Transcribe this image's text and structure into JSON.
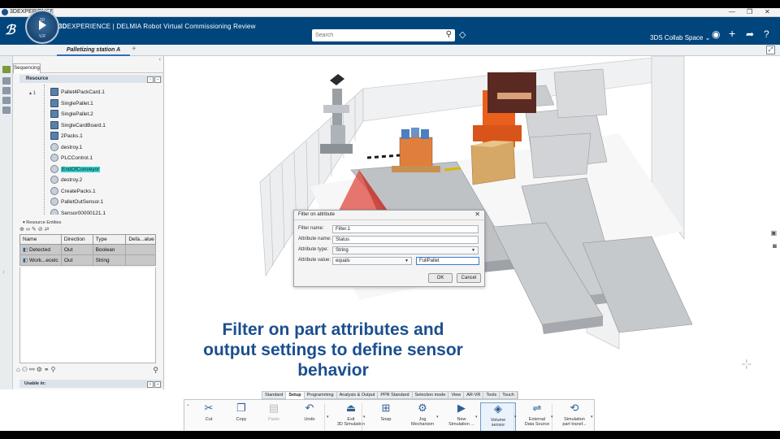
{
  "os_window": {
    "title": "3DEXPERIENCE",
    "controls": [
      "—",
      "❐",
      "✕"
    ]
  },
  "header": {
    "brand_bold": "3D",
    "brand_rest": "EXPERIENCE | DELMIA Robot Virtual Commissioning Review",
    "compass_labels": {
      "top": "3D",
      "bottom": "V,R"
    },
    "search_placeholder": "Search",
    "collab_space": "3DS Collab Space ⌄",
    "icons": [
      "user-icon",
      "plus-icon",
      "share-icon",
      "help-icon"
    ]
  },
  "tabbar": {
    "active_tab": "Palletizing station A",
    "add_label": "+"
  },
  "panel": {
    "tab_label": "Sequencing",
    "resource_header": "Resource",
    "tree_root_toggle": "▴ 1",
    "tree_items": [
      {
        "label": "Pallet4PackCard.1",
        "icon": "part-icon"
      },
      {
        "label": "SinglePallet.1",
        "icon": "part-icon"
      },
      {
        "label": "SinglePallet.2",
        "icon": "part-icon"
      },
      {
        "label": "SingleCardBoard.1",
        "icon": "part-icon"
      },
      {
        "label": "2Packs.1",
        "icon": "part-icon"
      },
      {
        "label": "destroy.1",
        "icon": "resource-icon"
      },
      {
        "label": "PLCControl.1",
        "icon": "resource-icon"
      },
      {
        "label": "EndOfConveyor",
        "icon": "sensor-icon",
        "highlighted": true
      },
      {
        "label": "destroy.2",
        "icon": "resource-icon"
      },
      {
        "label": "CreatePacks.1",
        "icon": "resource-icon"
      },
      {
        "label": "PalletOutSensor.1",
        "icon": "resource-icon"
      },
      {
        "label": "Sensor00000121.1",
        "icon": "resource-icon"
      }
    ],
    "entities_header": "▾ Resource Entities",
    "entities_columns": [
      "Name",
      "Direction",
      "Type",
      "Defa...alue"
    ],
    "entities_rows": [
      {
        "name": "Detected",
        "direction": "Out",
        "type": "Boolean",
        "default": ""
      },
      {
        "name": "Work...ecelc",
        "direction": "Out",
        "type": "String",
        "default": ""
      }
    ],
    "usable_header": "Usable in:"
  },
  "dialog": {
    "title": "Filter on attribute",
    "close": "✕",
    "filter_name_label": "Filter name:",
    "filter_name_value": "Filter.1",
    "attribute_name_label": "Attribute name:",
    "attribute_name_value": "Status",
    "attribute_type_label": "Attribute type:",
    "attribute_type_value": "String",
    "attribute_value_label": "Attribute value:",
    "operator_value": "equals",
    "value_text": "FullPallet",
    "ok_label": "OK",
    "cancel_label": "Cancel"
  },
  "caption": {
    "line1": "Filter on part attributes and",
    "line2": "output settings to define sensor",
    "line3": "behavior"
  },
  "ribbon": {
    "tabs": [
      "Standard",
      "Setup",
      "Programming",
      "Analysis & Output",
      "PPR Standard",
      "Selection mode",
      "View",
      "AR-VR",
      "Tools",
      "Touch"
    ],
    "active_tab": "Setup",
    "buttons": [
      {
        "label": "Cut",
        "icon": "scissors-icon"
      },
      {
        "label": "Copy",
        "icon": "copy-icon"
      },
      {
        "label": "Paste",
        "icon": "paste-icon",
        "disabled": true
      },
      {
        "label": "Undo",
        "icon": "undo-icon"
      },
      {
        "label": "Exit\n3D Simulation",
        "icon": "exit-simulation-icon"
      },
      {
        "label": "Snap",
        "icon": "snap-icon"
      },
      {
        "label": "Jog\nMechanism",
        "icon": "jog-mechanism-icon"
      },
      {
        "label": "New\nSimulation ...",
        "icon": "new-simulation-icon"
      },
      {
        "label": "Volume\nsensor",
        "icon": "volume-sensor-icon",
        "selected": true
      },
      {
        "label": "External\nData Source",
        "icon": "external-data-icon"
      },
      {
        "label": "Simulation\npart transf...",
        "icon": "part-transform-icon"
      }
    ]
  },
  "colors": {
    "header_bg": "#00457c",
    "caption": "#1b4f8f",
    "highlight": "#33d0ce",
    "sensor_cone": "#e04a3f",
    "robot": "#e8601c"
  }
}
